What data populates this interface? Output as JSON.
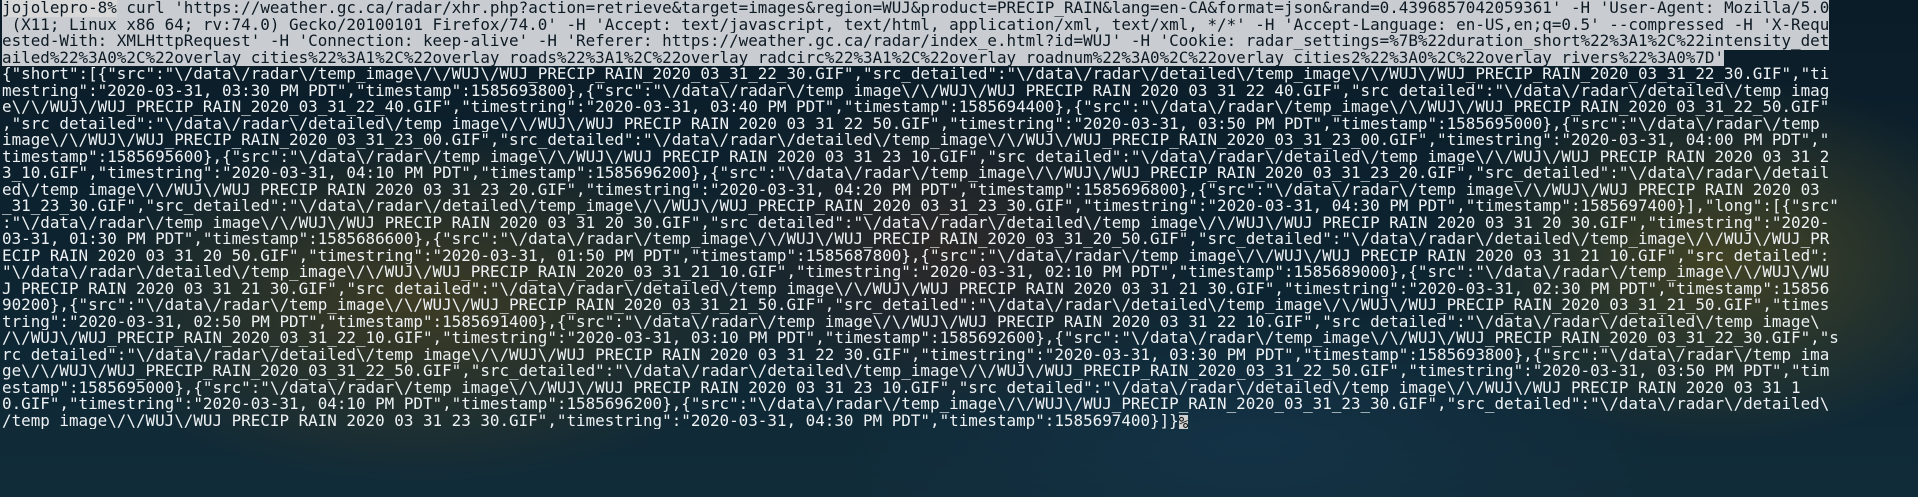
{
  "window": {
    "prompt": "jojolepro-8%",
    "command_lines": [
      " curl 'https://weather.gc.ca/radar/xhr.php?action=retrieve&target=images&region=WUJ&product=PRECIP_RAIN&lang=en-CA&format=json&rand=0.4396857042059361' -H 'User-Agent: Mozilla/5.0",
      " (X11; Linux x86_64; rv:74.0) Gecko/20100101 Firefox/74.0' -H 'Accept: text/javascript, text/html, application/xml, text/xml, */*' -H 'Accept-Language: en-US,en;q=0.5' --compressed -H 'X-Requ",
      "ested-With: XMLHttpRequest' -H 'Connection: keep-alive' -H 'Referer: https://weather.gc.ca/radar/index_e.html?id=WUJ' -H 'Cookie: radar_settings=%7B%22duration_short%22%3A1%2C%22intensity_det",
      "ailed%22%3A0%2C%22overlay_cities%22%3A1%2C%22overlay_roads%22%3A1%2C%22overlay_radcirc%22%3A1%2C%22overlay_roadnum%22%3A0%2C%22overlay_cities2%22%3A0%2C%22overlay_rivers%22%3A0%7D'"
    ],
    "output_lines": [
      "{\"short\":[{\"src\":\"\\/data\\/radar\\/temp_image\\/\\/WUJ\\/WUJ_PRECIP_RAIN_2020_03_31_22_30.GIF\",\"src_detailed\":\"\\/data\\/radar\\/detailed\\/temp_image\\/\\/WUJ\\/WUJ_PRECIP_RAIN_2020_03_31_22_30.GIF\",\"ti",
      "mestring\":\"2020-03-31, 03:30 PM PDT\",\"timestamp\":1585693800},{\"src\":\"\\/data\\/radar\\/temp_image\\/\\/WUJ\\/WUJ_PRECIP_RAIN_2020_03_31_22_40.GIF\",\"src_detailed\":\"\\/data\\/radar\\/detailed\\/temp_imag",
      "e\\/\\/WUJ\\/WUJ_PRECIP_RAIN_2020_03_31_22_40.GIF\",\"timestring\":\"2020-03-31, 03:40 PM PDT\",\"timestamp\":1585694400},{\"src\":\"\\/data\\/radar\\/temp_image\\/\\/WUJ\\/WUJ_PRECIP_RAIN_2020_03_31_22_50.GIF\"",
      ",\"src_detailed\":\"\\/data\\/radar\\/detailed\\/temp_image\\/\\/WUJ\\/WUJ_PRECIP_RAIN_2020_03_31_22_50.GIF\",\"timestring\":\"2020-03-31, 03:50 PM PDT\",\"timestamp\":1585695000},{\"src\":\"\\/data\\/radar\\/temp_",
      "image\\/\\/WUJ\\/WUJ_PRECIP_RAIN_2020_03_31_23_00.GIF\",\"src_detailed\":\"\\/data\\/radar\\/detailed\\/temp_image\\/\\/WUJ\\/WUJ_PRECIP_RAIN_2020_03_31_23_00.GIF\",\"timestring\":\"2020-03-31, 04:00 PM PDT\",\"",
      "timestamp\":1585695600},{\"src\":\"\\/data\\/radar\\/temp_image\\/\\/WUJ\\/WUJ_PRECIP_RAIN_2020_03_31_23_10.GIF\",\"src_detailed\":\"\\/data\\/radar\\/detailed\\/temp_image\\/\\/WUJ\\/WUJ_PRECIP_RAIN_2020_03_31_2",
      "3_10.GIF\",\"timestring\":\"2020-03-31, 04:10 PM PDT\",\"timestamp\":1585696200},{\"src\":\"\\/data\\/radar\\/temp_image\\/\\/WUJ\\/WUJ_PRECIP_RAIN_2020_03_31_23_20.GIF\",\"src_detailed\":\"\\/data\\/radar\\/detail",
      "ed\\/temp_image\\/\\/WUJ\\/WUJ_PRECIP_RAIN_2020_03_31_23_20.GIF\",\"timestring\":\"2020-03-31, 04:20 PM PDT\",\"timestamp\":1585696800},{\"src\":\"\\/data\\/radar\\/temp_image\\/\\/WUJ\\/WUJ_PRECIP_RAIN_2020_03",
      "_31_23_30.GIF\",\"src_detailed\":\"\\/data\\/radar\\/detailed\\/temp_image\\/\\/WUJ\\/WUJ_PRECIP_RAIN_2020_03_31_23_30.GIF\",\"timestring\":\"2020-03-31, 04:30 PM PDT\",\"timestamp\":1585697400}],\"long\":[{\"src\"",
      ":\"\\/data\\/radar\\/temp_image\\/\\/WUJ\\/WUJ_PRECIP_RAIN_2020_03_31_20_30.GIF\",\"src_detailed\":\"\\/data\\/radar\\/detailed\\/temp_image\\/\\/WUJ\\/WUJ_PRECIP_RAIN_2020_03_31_20_30.GIF\",\"timestring\":\"2020-",
      "03-31, 01:30 PM PDT\",\"timestamp\":1585686600},{\"src\":\"\\/data\\/radar\\/temp_image\\/\\/WUJ\\/WUJ_PRECIP_RAIN_2020_03_31_20_50.GIF\",\"src_detailed\":\"\\/data\\/radar\\/detailed\\/temp_image\\/\\/WUJ\\/WUJ_PR",
      "ECIP_RAIN_2020_03_31_20_50.GIF\",\"timestring\":\"2020-03-31, 01:50 PM PDT\",\"timestamp\":1585687800},{\"src\":\"\\/data\\/radar\\/temp_image\\/\\/WUJ\\/WUJ_PRECIP_RAIN_2020_03_31_21_10.GIF\",\"src_detailed\":",
      "\"\\/data\\/radar\\/detailed\\/temp_image\\/\\/WUJ\\/WUJ_PRECIP_RAIN_2020_03_31_21_10.GIF\",\"timestring\":\"2020-03-31, 02:10 PM PDT\",\"timestamp\":1585689000},{\"src\":\"\\/data\\/radar\\/temp_image\\/\\/WUJ\\/WU",
      "J_PRECIP_RAIN_2020_03_31_21_30.GIF\",\"src_detailed\":\"\\/data\\/radar\\/detailed\\/temp_image\\/\\/WUJ\\/WUJ_PRECIP_RAIN_2020_03_31_21_30.GIF\",\"timestring\":\"2020-03-31, 02:30 PM PDT\",\"timestamp\":15856",
      "90200},{\"src\":\"\\/data\\/radar\\/temp_image\\/\\/WUJ\\/WUJ_PRECIP_RAIN_2020_03_31_21_50.GIF\",\"src_detailed\":\"\\/data\\/radar\\/detailed\\/temp_image\\/\\/WUJ\\/WUJ_PRECIP_RAIN_2020_03_31_21_50.GIF\",\"times",
      "tring\":\"2020-03-31, 02:50 PM PDT\",\"timestamp\":1585691400},{\"src\":\"\\/data\\/radar\\/temp_image\\/\\/WUJ\\/WUJ_PRECIP_RAIN_2020_03_31_22_10.GIF\",\"src_detailed\":\"\\/data\\/radar\\/detailed\\/temp_image\\",
      "/\\/WUJ\\/WUJ_PRECIP_RAIN_2020_03_31_22_10.GIF\",\"timestring\":\"2020-03-31, 03:10 PM PDT\",\"timestamp\":1585692600},{\"src\":\"\\/data\\/radar\\/temp_image\\/\\/WUJ\\/WUJ_PRECIP_RAIN_2020_03_31_22_30.GIF\",\"s",
      "rc_detailed\":\"\\/data\\/radar\\/detailed\\/temp_image\\/\\/WUJ\\/WUJ_PRECIP_RAIN_2020_03_31_22_30.GIF\",\"timestring\":\"2020-03-31, 03:30 PM PDT\",\"timestamp\":1585693800},{\"src\":\"\\/data\\/radar\\/temp_ima",
      "ge\\/\\/WUJ\\/WUJ_PRECIP_RAIN_2020_03_31_22_50.GIF\",\"src_detailed\":\"\\/data\\/radar\\/detailed\\/temp_image\\/\\/WUJ\\/WUJ_PRECIP_RAIN_2020_03_31_22_50.GIF\",\"timestring\":\"2020-03-31, 03:50 PM PDT\",\"tim",
      "estamp\":1585695000},{\"src\":\"\\/data\\/radar\\/temp_image\\/\\/WUJ\\/WUJ_PRECIP_RAIN_2020_03_31_23_10.GIF\",\"src_detailed\":\"\\/data\\/radar\\/detailed\\/temp_image\\/\\/WUJ\\/WUJ_PRECIP_RAIN_2020_03_31_1",
      "0.GIF\",\"timestring\":\"2020-03-31, 04:10 PM PDT\",\"timestamp\":1585696200},{\"src\":\"\\/data\\/radar\\/temp_image\\/\\/WUJ\\/WUJ_PRECIP_RAIN_2020_03_31_23_30.GIF\",\"src_detailed\":\"\\/data\\/radar\\/detailed\\",
      "/temp_image\\/\\/WUJ\\/WUJ_PRECIP_RAIN_2020_03_31_23_30.GIF\",\"timestring\":\"2020-03-31, 04:30 PM PDT\",\"timestamp\":1585697400}]}"
    ],
    "cursor_glyph": "%",
    "colors": {
      "prompt_bg": "#d8d8d8",
      "command_bg": "#c9ccd0",
      "output_fg": "#eef2f4",
      "background": "#0d1a24"
    }
  }
}
